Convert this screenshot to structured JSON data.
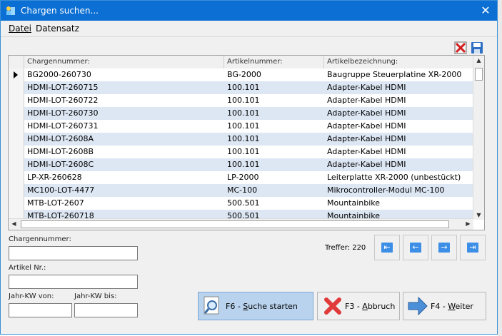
{
  "window": {
    "title": "Chargen suchen...",
    "close_glyph": "✕"
  },
  "menu": {
    "datei": "Datei",
    "datensatz": "Datensatz"
  },
  "toolbar": {
    "delete_icon": "delete-filter-icon",
    "save_icon": "save-icon"
  },
  "table": {
    "columns": [
      "Chargennummer:",
      "Artikelnummer:",
      "Artikelbezeichnung:"
    ],
    "rows": [
      {
        "charge": "BG2000-260730",
        "artikel": "BG-2000",
        "bezeichnung": "Baugruppe Steuerplatine XR-2000"
      },
      {
        "charge": "HDMI-LOT-260715",
        "artikel": "100.101",
        "bezeichnung": "Adapter-Kabel HDMI"
      },
      {
        "charge": "HDMI-LOT-260722",
        "artikel": "100.101",
        "bezeichnung": "Adapter-Kabel HDMI"
      },
      {
        "charge": "HDMI-LOT-260730",
        "artikel": "100.101",
        "bezeichnung": "Adapter-Kabel HDMI"
      },
      {
        "charge": "HDMI-LOT-260731",
        "artikel": "100.101",
        "bezeichnung": "Adapter-Kabel HDMI"
      },
      {
        "charge": "HDMI-LOT-2608A",
        "artikel": "100.101",
        "bezeichnung": "Adapter-Kabel HDMI"
      },
      {
        "charge": "HDMI-LOT-2608B",
        "artikel": "100.101",
        "bezeichnung": "Adapter-Kabel HDMI"
      },
      {
        "charge": "HDMI-LOT-2608C",
        "artikel": "100.101",
        "bezeichnung": "Adapter-Kabel HDMI"
      },
      {
        "charge": "LP-XR-260628",
        "artikel": "LP-2000",
        "bezeichnung": "Leiterplatte XR-2000 (unbestückt)"
      },
      {
        "charge": "MC100-LOT-4477",
        "artikel": "MC-100",
        "bezeichnung": "Mikrocontroller-Modul MC-100"
      },
      {
        "charge": "MTB-LOT-2607",
        "artikel": "500.501",
        "bezeichnung": "Mountainbike"
      },
      {
        "charge": "MTB-LOT-260718",
        "artikel": "500.501",
        "bezeichnung": "Mountainbike"
      }
    ]
  },
  "filters": {
    "chargennummer_label": "Chargennummer:",
    "chargennummer_value": "",
    "artikel_label": "Artikel Nr.:",
    "artikel_value": "",
    "kw_von_label": "Jahr-KW von:",
    "kw_von_value": "",
    "kw_bis_label": "Jahr-KW bis:",
    "kw_bis_value": ""
  },
  "treffer": "Treffer: 220",
  "nav": {
    "first": "⇤",
    "prev": "←",
    "next": "→",
    "last": "⇥"
  },
  "buttons": {
    "search": {
      "prefix": "F6 - ",
      "underline": "S",
      "rest": "uche starten"
    },
    "cancel": {
      "prefix": "F3 - ",
      "underline": "A",
      "rest": "bbruch"
    },
    "next": {
      "prefix": "F4 - ",
      "underline": "W",
      "rest": "eiter"
    }
  },
  "colors": {
    "titlebar": "#0b6fd3",
    "row_alt": "#dde7f4",
    "active_button": "#b9d3ee",
    "nav_icon": "#3c8ee6"
  }
}
